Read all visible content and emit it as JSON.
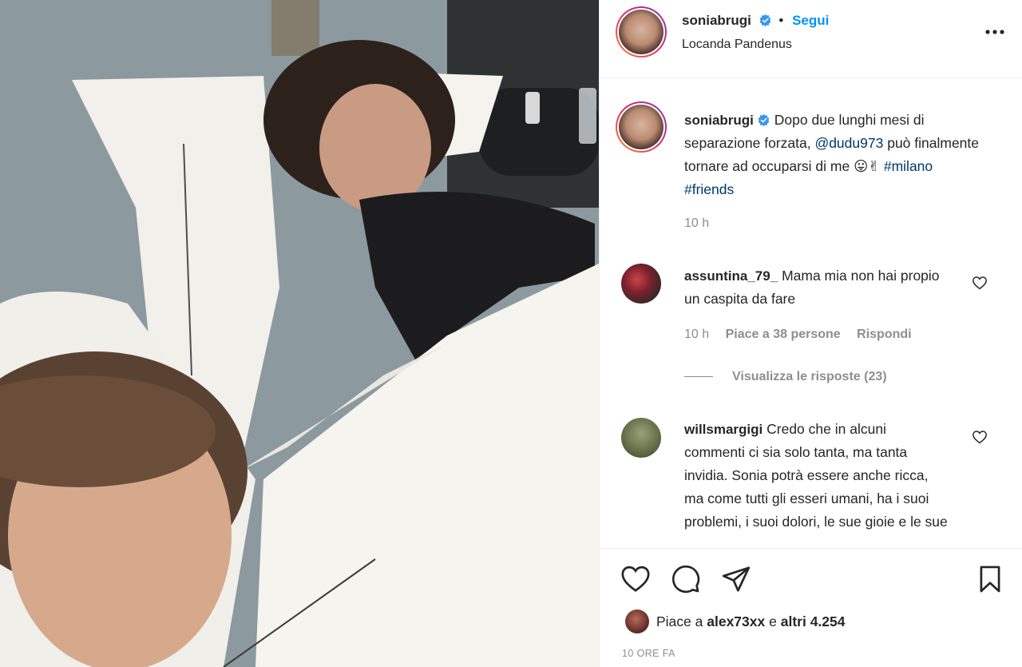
{
  "post": {
    "username": "soniabrugi",
    "follow_label": "Segui",
    "separator": "•",
    "location": "Locanda Pandenus"
  },
  "caption": {
    "username": "soniabrugi",
    "text_1": "Dopo due lunghi mesi di separazione forzata, ",
    "mention": "@dudu973",
    "text_2": " può finalmente tornare ad occuparsi di me ",
    "emoji": "😛✌",
    "hashtag_1": "#milano",
    "hashtag_2": "#friends",
    "time": "10 h"
  },
  "comments": [
    {
      "username": "assuntina_79_",
      "text": "Mama mia non hai propio un caspita da fare",
      "time": "10 h",
      "likes": "Piace a 38 persone",
      "reply": "Rispondi",
      "view_replies": "Visualizza le risposte (23)"
    },
    {
      "username": "willsmargigi",
      "text": "Credo che in alcuni commenti ci sia solo tanta, ma tanta invidia. Sonia potrà essere anche ricca, ma come tutti gli esseri umani, ha i suoi problemi, i suoi dolori, le sue gioie e le sue"
    }
  ],
  "likes_bar": {
    "prefix": "Piace a ",
    "user": "alex73xx",
    "middle": " e ",
    "others": "altri 4.254"
  },
  "post_time": "10 ORE FA",
  "icons": [
    "verified-badge-icon",
    "more-options-icon",
    "heart-icon",
    "comment-icon",
    "share-icon",
    "bookmark-icon"
  ],
  "colors": {
    "link_blue": "#0095f6",
    "mention_blue": "#00376b",
    "muted": "#8e8e8e",
    "verified": "#3897f0"
  }
}
